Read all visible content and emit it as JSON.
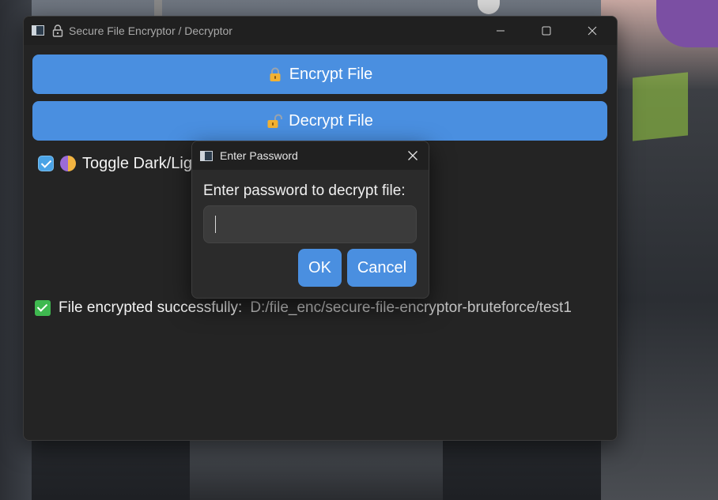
{
  "window": {
    "title": "Secure File Encryptor / Decryptor",
    "controls": {
      "minimize": "—",
      "maximize": "☐",
      "close": "✕"
    }
  },
  "main": {
    "encrypt_button": {
      "label": "Encrypt File",
      "icon": "locked-padlock-icon"
    },
    "decrypt_button": {
      "label": "Decrypt File",
      "icon": "unlocked-padlock-icon"
    },
    "theme_toggle": {
      "label": "Toggle Dark/Light Mode",
      "checked": true,
      "icon": "theme-icon"
    },
    "status": {
      "message": "File encrypted successfully:",
      "path": "D:/file_enc/secure-file-encryptor-bruteforce/test1",
      "icon": "success-check-icon"
    }
  },
  "dialog": {
    "title": "Enter Password",
    "close": "✕",
    "prompt": "Enter password to decrypt file:",
    "password_value": "",
    "ok_label": "OK",
    "cancel_label": "Cancel"
  },
  "colors": {
    "accent": "#4a8fe0",
    "window_bg": "#242424",
    "titlebar_bg": "#202020",
    "success": "#3fb950"
  }
}
